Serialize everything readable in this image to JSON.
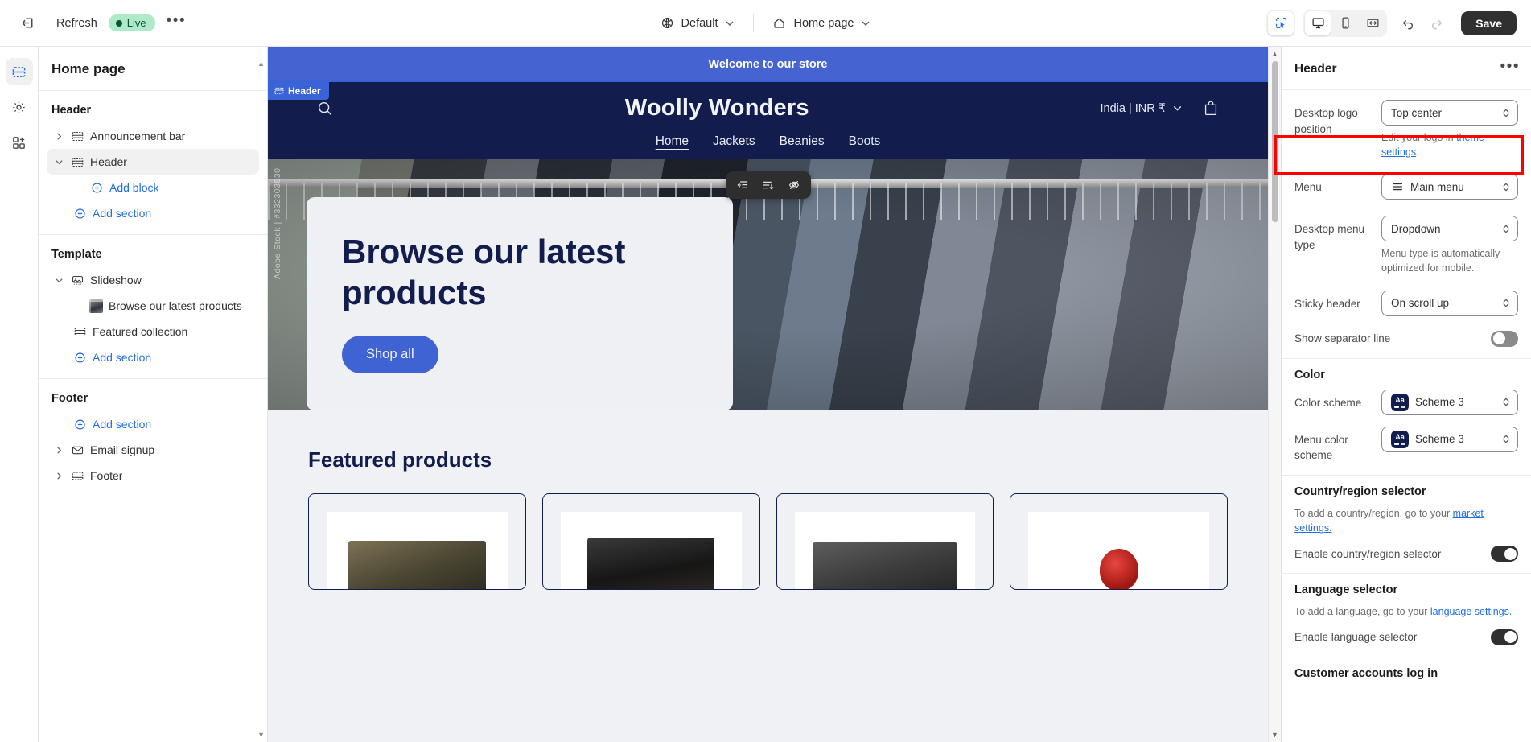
{
  "topbar": {
    "exit_icon": "exit-icon",
    "refresh_label": "Refresh",
    "live_label": "Live",
    "more_label": "•••",
    "theme_selector": {
      "icon": "globe-icon",
      "value": "Default"
    },
    "page_selector": {
      "icon": "home-icon",
      "value": "Home page"
    },
    "tools": {
      "select_tool": "select-cursor-icon",
      "desktop": "desktop-icon",
      "mobile": "mobile-icon",
      "fullwidth": "fullwidth-icon",
      "undo": "undo-icon",
      "redo": "redo-icon"
    },
    "save_label": "Save"
  },
  "rail": {
    "items": [
      {
        "name": "sections-icon",
        "active": true
      },
      {
        "name": "gear-icon",
        "active": false
      },
      {
        "name": "apps-icon",
        "active": false
      }
    ]
  },
  "sidebar": {
    "title": "Home page",
    "groups": [
      {
        "title": "Header",
        "items": [
          {
            "label": "Announcement bar",
            "icon": "section-icon",
            "chevron": "right",
            "indent": 0,
            "type": "section",
            "selected": false
          },
          {
            "label": "Header",
            "icon": "section-icon",
            "chevron": "down",
            "indent": 0,
            "type": "section",
            "selected": true
          },
          {
            "label": "Add block",
            "icon": "plus-circle-icon",
            "indent": 2,
            "type": "add"
          },
          {
            "label": "Add section",
            "icon": "plus-circle-icon",
            "indent": 1,
            "type": "add"
          }
        ]
      },
      {
        "title": "Template",
        "items": [
          {
            "label": "Slideshow",
            "icon": "slideshow-icon",
            "chevron": "down",
            "indent": 0,
            "type": "section",
            "selected": false
          },
          {
            "label": "Browse our latest products",
            "icon": "image-thumb",
            "indent": 2,
            "type": "block"
          },
          {
            "label": "Featured collection",
            "icon": "collection-icon",
            "indent": 1,
            "type": "section"
          },
          {
            "label": "Add section",
            "icon": "plus-circle-icon",
            "indent": 1,
            "type": "add"
          }
        ]
      },
      {
        "title": "Footer",
        "items": [
          {
            "label": "Add section",
            "icon": "plus-circle-icon",
            "indent": 1,
            "type": "add"
          },
          {
            "label": "Email signup",
            "icon": "email-icon",
            "chevron": "right",
            "indent": 0,
            "type": "section"
          },
          {
            "label": "Footer",
            "icon": "footer-icon",
            "chevron": "right",
            "indent": 0,
            "type": "section"
          }
        ]
      }
    ]
  },
  "preview": {
    "section_tag": "Header",
    "announcement": "Welcome to our store",
    "store": {
      "logo": "Woolly Wonders",
      "search_icon": "search-icon",
      "country_value": "India | INR ₹",
      "cart_icon": "shopping-bag-icon",
      "nav": [
        {
          "label": "Home",
          "current": true
        },
        {
          "label": "Jackets",
          "current": false
        },
        {
          "label": "Beanies",
          "current": false
        },
        {
          "label": "Boots",
          "current": false
        }
      ]
    },
    "hero": {
      "heading": "Browse our latest products",
      "button": "Shop all",
      "watermark": "Adobe Stock | #332303530",
      "toolbar": [
        "move-out-icon",
        "reorder-icon",
        "hide-eye-icon"
      ]
    },
    "featured": {
      "title": "Featured products",
      "products": [
        "product-1",
        "product-2",
        "product-3",
        "product-4"
      ]
    }
  },
  "panel": {
    "title": "Header",
    "more_label": "•••",
    "settings": {
      "desktop_logo_position": {
        "label": "Desktop logo position",
        "value": "Top center",
        "hint_prefix": "Edit your logo in ",
        "hint_link": "theme settings",
        "hint_suffix": "."
      },
      "menu": {
        "label": "Menu",
        "value": "Main menu",
        "icon": "hamburger-icon",
        "highlighted": true
      },
      "desktop_menu_type": {
        "label": "Desktop menu type",
        "value": "Dropdown",
        "hint": "Menu type is automatically optimized for mobile."
      },
      "sticky_header": {
        "label": "Sticky header",
        "value": "On scroll up"
      },
      "show_separator_line": {
        "label": "Show separator line",
        "enabled": false
      }
    },
    "color": {
      "title": "Color",
      "color_scheme": {
        "label": "Color scheme",
        "value": "Scheme 3",
        "swatch": "Aa"
      },
      "menu_color_scheme": {
        "label": "Menu color scheme",
        "value": "Scheme 3",
        "swatch": "Aa"
      }
    },
    "country": {
      "title": "Country/region selector",
      "desc_prefix": "To add a country/region, go to your ",
      "desc_link": "market settings.",
      "toggle_label": "Enable country/region selector",
      "enabled": true
    },
    "language": {
      "title": "Language selector",
      "desc_prefix": "To add a language, go to your ",
      "desc_link": "language settings.",
      "toggle_label": "Enable language selector",
      "enabled": true
    },
    "customer_accounts": {
      "title": "Customer accounts log in"
    }
  },
  "colors": {
    "accent_blue": "#1f6fe5",
    "store_navy": "#121d4e",
    "announcement_blue": "#4563d1",
    "highlight_red": "#ff0000",
    "live_green": "#aee9c9"
  }
}
